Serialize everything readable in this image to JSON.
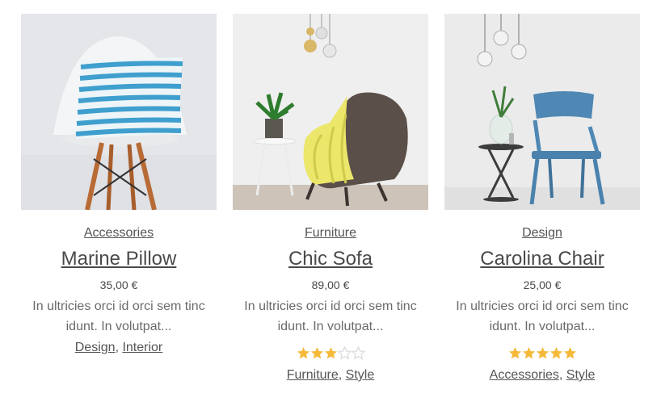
{
  "products": [
    {
      "category": "Accessories",
      "title": "Marine Pillow",
      "price": "35,00 €",
      "excerpt": "In ultricies orci id orci sem tinc idunt. In volutpat...",
      "rating": null,
      "tags": [
        "Design",
        "Interior"
      ],
      "tag_separator": ", "
    },
    {
      "category": "Furniture",
      "title": "Chic Sofa",
      "price": "89,00 €",
      "excerpt": "In ultricies orci id orci sem tinc idunt. In volutpat...",
      "rating": 3,
      "tags": [
        "Furniture",
        "Style"
      ],
      "tag_separator": ", "
    },
    {
      "category": "Design",
      "title": "Carolina Chair",
      "price": "25,00 €",
      "excerpt": "In ultricies orci id orci sem tinc idunt. In volutpat...",
      "rating": 5,
      "tags": [
        "Accessories",
        "Style"
      ],
      "tag_separator": ", "
    }
  ],
  "rating_max": 5,
  "colors": {
    "star": "#f5b93a",
    "star_empty": "#d9d9d9"
  },
  "icons": {
    "star_filled": "star-filled-icon",
    "star_empty": "star-empty-icon"
  }
}
